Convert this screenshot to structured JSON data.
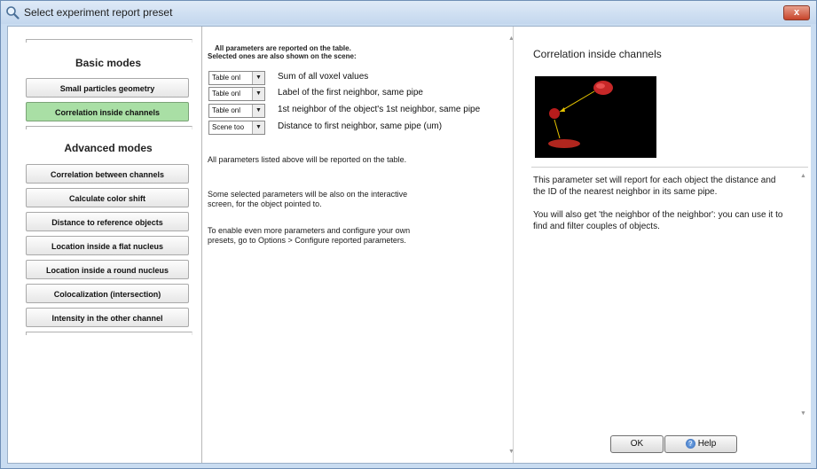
{
  "window": {
    "title": "Select experiment report preset",
    "close_label": "x"
  },
  "left": {
    "basic_title": "Basic modes",
    "basic_modes": [
      {
        "label": "Small particles geometry",
        "selected": false
      },
      {
        "label": "Correlation inside channels",
        "selected": true
      }
    ],
    "advanced_title": "Advanced modes",
    "advanced_modes": [
      {
        "label": "Correlation between channels"
      },
      {
        "label": "Calculate color shift"
      },
      {
        "label": "Distance to reference objects"
      },
      {
        "label": "Location inside a flat nucleus"
      },
      {
        "label": "Location inside a round nucleus"
      },
      {
        "label": "Colocalization (intersection)"
      },
      {
        "label": "Intensity in the other channel"
      }
    ],
    "selected_color": "#a9dfa5"
  },
  "middle": {
    "header_line1": "All parameters are reported on the table.",
    "header_line2": "Selected ones are also shown on the scene:",
    "params": [
      {
        "option": "Table onl",
        "label": "Sum of all voxel values"
      },
      {
        "option": "Table onl",
        "label": "Label of the first neighbor, same pipe"
      },
      {
        "option": "Table onl",
        "label": "1st neighbor of the object's 1st neighbor, same pipe"
      },
      {
        "option": "Scene too",
        "label": "Distance to first neighbor, same pipe (um)"
      }
    ],
    "info1": "All parameters listed above will be reported on the table.",
    "info2": "Some selected parameters will be also on the interactive screen, for the object pointed to.",
    "info3": "To enable even more parameters and configure your own presets, go to Options > Configure reported parameters."
  },
  "right": {
    "title": "Correlation inside channels",
    "desc1": "This parameter set will report for each object the distance and the ID of the nearest neighbor in its same pipe.",
    "desc2": "You will also get  'the neighbor of the neighbor': you can use it to find and filter couples of objects.",
    "ok_label": "OK",
    "help_label": "Help"
  },
  "icons": {
    "title": "magnifier-icon",
    "dropdown": "chevron-down-icon",
    "help": "help-icon"
  }
}
